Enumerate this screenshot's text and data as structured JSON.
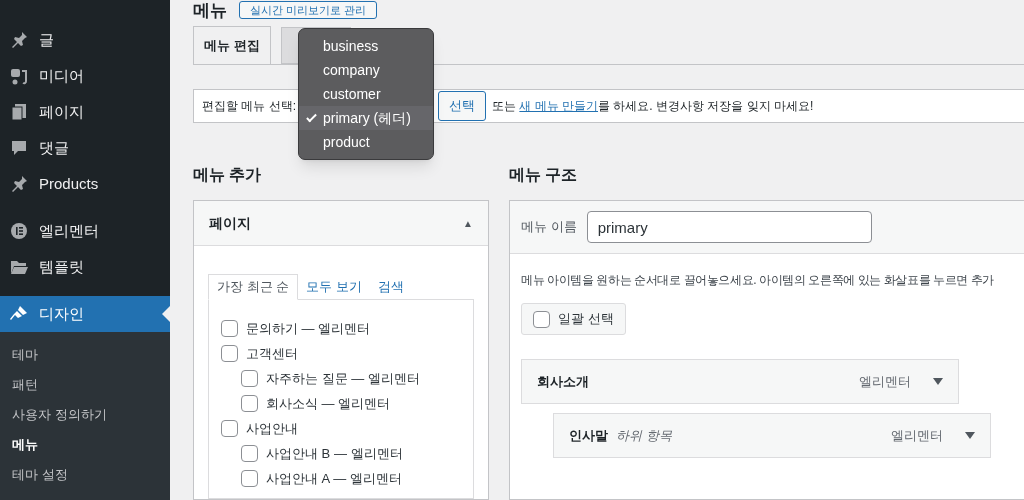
{
  "sidebar": {
    "items": [
      {
        "label": "글",
        "selected": false
      },
      {
        "label": "미디어",
        "selected": false
      },
      {
        "label": "페이지",
        "selected": false
      },
      {
        "label": "댓글",
        "selected": false
      },
      {
        "label": "Products",
        "selected": false
      },
      {
        "label": "엘리멘터",
        "selected": false
      },
      {
        "label": "템플릿",
        "selected": false
      },
      {
        "label": "디자인",
        "selected": true
      }
    ],
    "submenu": [
      {
        "label": "테마",
        "selected": false
      },
      {
        "label": "패턴",
        "selected": false
      },
      {
        "label": "사용자 정의하기",
        "selected": false
      },
      {
        "label": "메뉴",
        "selected": true
      },
      {
        "label": "테마 설정",
        "selected": false
      }
    ]
  },
  "page": {
    "title": "메뉴",
    "preview_button": "실시간 미리보기로 관리"
  },
  "tabs": [
    {
      "label": "메뉴 편집",
      "selected": true
    },
    {
      "selected": false
    }
  ],
  "select_bar": {
    "label": "편집할 메뉴 선택:",
    "button": "선택",
    "note": "또는 ",
    "link": "새 메뉴 만들기",
    "note_after": "를 하세요. 변경사항 저장을 잊지 마세요!"
  },
  "dropdown": {
    "options": [
      {
        "label": "business",
        "selected": false
      },
      {
        "label": "company",
        "selected": false
      },
      {
        "label": "customer",
        "selected": false
      },
      {
        "label": "primary (헤더)",
        "selected": true
      },
      {
        "label": "product",
        "selected": false
      }
    ]
  },
  "add_menu": {
    "title": "메뉴 추가",
    "panel_title": "페이지",
    "toggle": "▲",
    "tabs": [
      {
        "label": "가장 최근 순",
        "selected": true
      },
      {
        "label": "모두 보기",
        "selected": false
      },
      {
        "label": "검색",
        "selected": false
      }
    ],
    "items": [
      {
        "label": "문의하기 — 엘리멘터",
        "checked": false
      },
      {
        "label": "고객센터",
        "checked": false,
        "children": [
          {
            "label": "자주하는 질문 — 엘리멘터",
            "checked": false
          },
          {
            "label": "회사소식 — 엘리멘터",
            "checked": false
          }
        ]
      },
      {
        "label": "사업안내",
        "checked": false,
        "children": [
          {
            "label": "사업안내 B — 엘리멘터",
            "checked": false
          },
          {
            "label": "사업안내 A — 엘리멘터",
            "checked": false
          }
        ]
      }
    ]
  },
  "structure": {
    "title": "메뉴 구조",
    "name_label": "메뉴 이름",
    "name_value": "primary",
    "description": "메뉴 아이템을 원하는 순서대로 끌어놓으세요. 아이템의 오른쪽에 있는 화살표를 누르면 추가",
    "bulk_select": {
      "label": "일괄 선택",
      "checked": false
    },
    "items": [
      {
        "label": "회사소개",
        "type": "엘리멘터",
        "children": [
          {
            "label": "인사말",
            "sub": "하위 항목",
            "type": "엘리멘터"
          }
        ]
      }
    ]
  }
}
